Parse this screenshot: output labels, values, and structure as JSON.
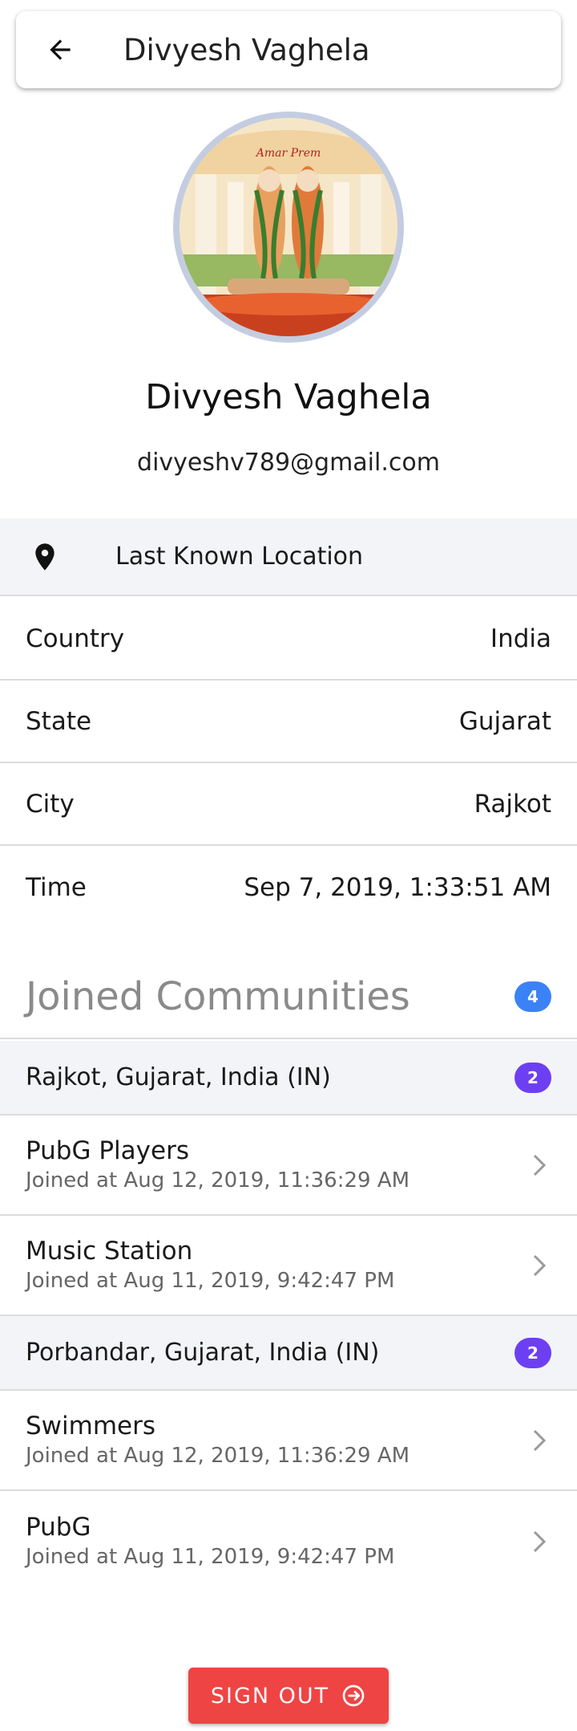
{
  "header": {
    "title": "Divyesh Vaghela",
    "back_icon": "arrow-left-icon"
  },
  "profile": {
    "name": "Divyesh Vaghela",
    "email": "divyeshv789@gmail.com",
    "avatar_caption": "Amar Prem"
  },
  "location": {
    "title": "Last Known Location",
    "icon": "location-pin-icon",
    "rows": [
      {
        "label": "Country",
        "value": "India"
      },
      {
        "label": "State",
        "value": "Gujarat"
      },
      {
        "label": "City",
        "value": "Rajkot"
      },
      {
        "label": "Time",
        "value": "Sep 7, 2019, 1:33:51 AM"
      }
    ]
  },
  "communities": {
    "title": "Joined Communities",
    "count": "4",
    "groups": [
      {
        "name": "Rajkot, Gujarat, India (IN)",
        "count": "2",
        "items": [
          {
            "name": "PubG Players",
            "joined": "Joined at Aug 12, 2019, 11:36:29 AM"
          },
          {
            "name": "Music Station",
            "joined": "Joined at Aug 11, 2019, 9:42:47 PM"
          }
        ]
      },
      {
        "name": "Porbandar, Gujarat, India (IN)",
        "count": "2",
        "items": [
          {
            "name": "Swimmers",
            "joined": "Joined at Aug 12, 2019, 11:36:29 AM"
          },
          {
            "name": "PubG",
            "joined": "Joined at Aug 11, 2019, 9:42:47 PM"
          }
        ]
      }
    ]
  },
  "signout": {
    "label": "SIGN OUT",
    "icon": "logout-icon"
  },
  "colors": {
    "accent_blue": "#3b82f6",
    "accent_purple": "#6d3ff2",
    "signout_red": "#ef4444",
    "section_bg": "#f3f4f7"
  }
}
